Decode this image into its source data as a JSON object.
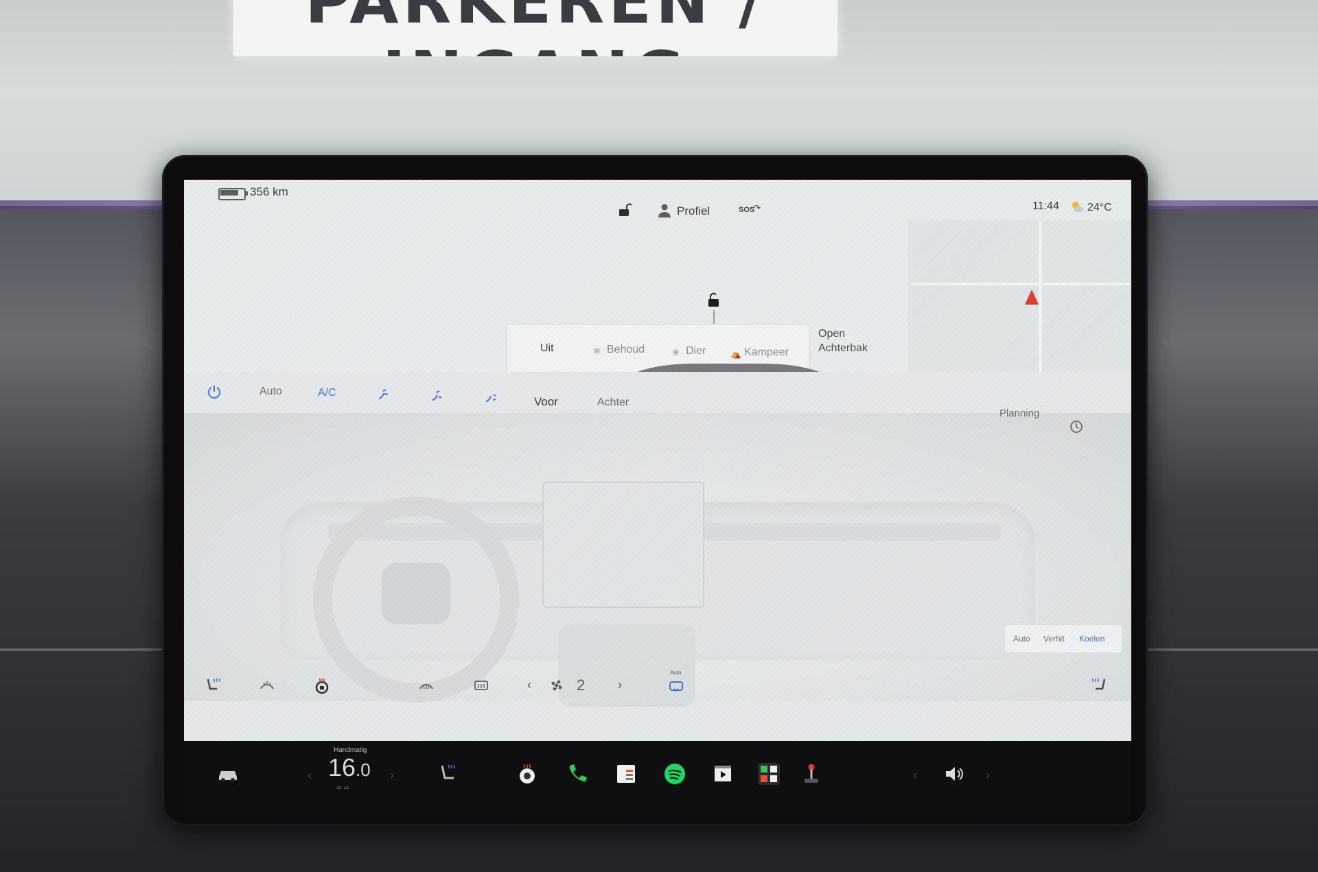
{
  "environment": {
    "sign_text": "PARKEREN / INGANG"
  },
  "status_bar": {
    "range": "356 km",
    "profile_label": "Profiel",
    "sos_label": "SOS",
    "time": "11:44",
    "temperature": "24°C"
  },
  "car_panel": {
    "modes": [
      "Uit",
      "Behoud",
      "Dier",
      "Kampeer"
    ],
    "trunk_line1": "Open",
    "trunk_line2": "Achterbak"
  },
  "climate": {
    "auto_label": "Auto",
    "ac_label": "A/C",
    "front_label": "Voor",
    "rear_label": "Achter",
    "schedule_label": "Planning",
    "fan_speed": "2",
    "recirc_label": "Auto",
    "hvac_modes": [
      "Auto",
      "Verhit",
      "Koelen"
    ],
    "hvac_active": "Koelen",
    "colors": {
      "accent": "#3a6fd8",
      "heat": "#d83a3a"
    }
  },
  "dock": {
    "temp_mode": "Handmatig",
    "temp_value_int": "16",
    "temp_value_dec": ".0",
    "icons": [
      "car-icon",
      "seat-heat-icon",
      "steering-wheel-heat-icon",
      "phone-icon",
      "calendar-icon",
      "spotify-icon",
      "theater-icon",
      "apps-icon",
      "joystick-icon",
      "volume-icon"
    ]
  }
}
